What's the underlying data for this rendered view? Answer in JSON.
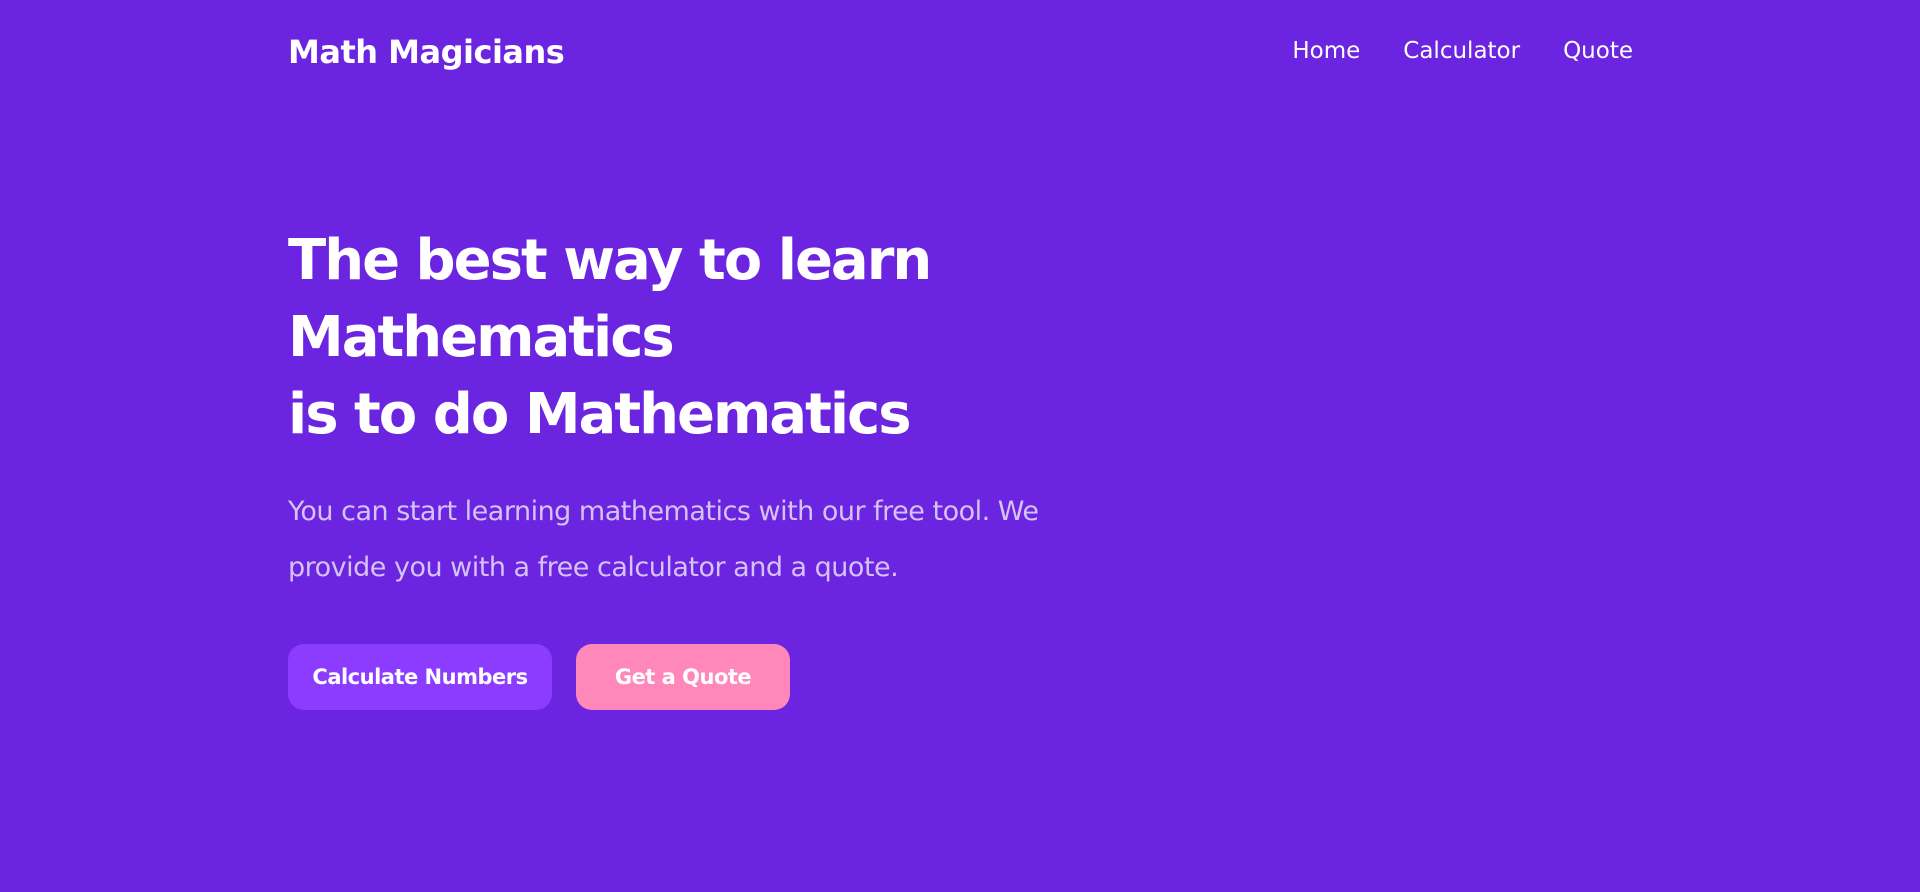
{
  "header": {
    "brand": "Math Magicians",
    "nav": [
      {
        "label": "Home"
      },
      {
        "label": "Calculator"
      },
      {
        "label": "Quote"
      }
    ]
  },
  "hero": {
    "title_line1": "The best way to learn Mathematics",
    "title_line2": "is to do Mathematics",
    "subtitle": "You can start learning mathematics with our free tool. We provide you with a free calculator and a quote.",
    "buttons": {
      "calculate": "Calculate Numbers",
      "quote": "Get a Quote"
    }
  },
  "colors": {
    "background": "#6b24e0",
    "primary_button": "#8c3cff",
    "secondary_button": "#ff87b9",
    "subtitle_text": "#d5c2f6"
  }
}
